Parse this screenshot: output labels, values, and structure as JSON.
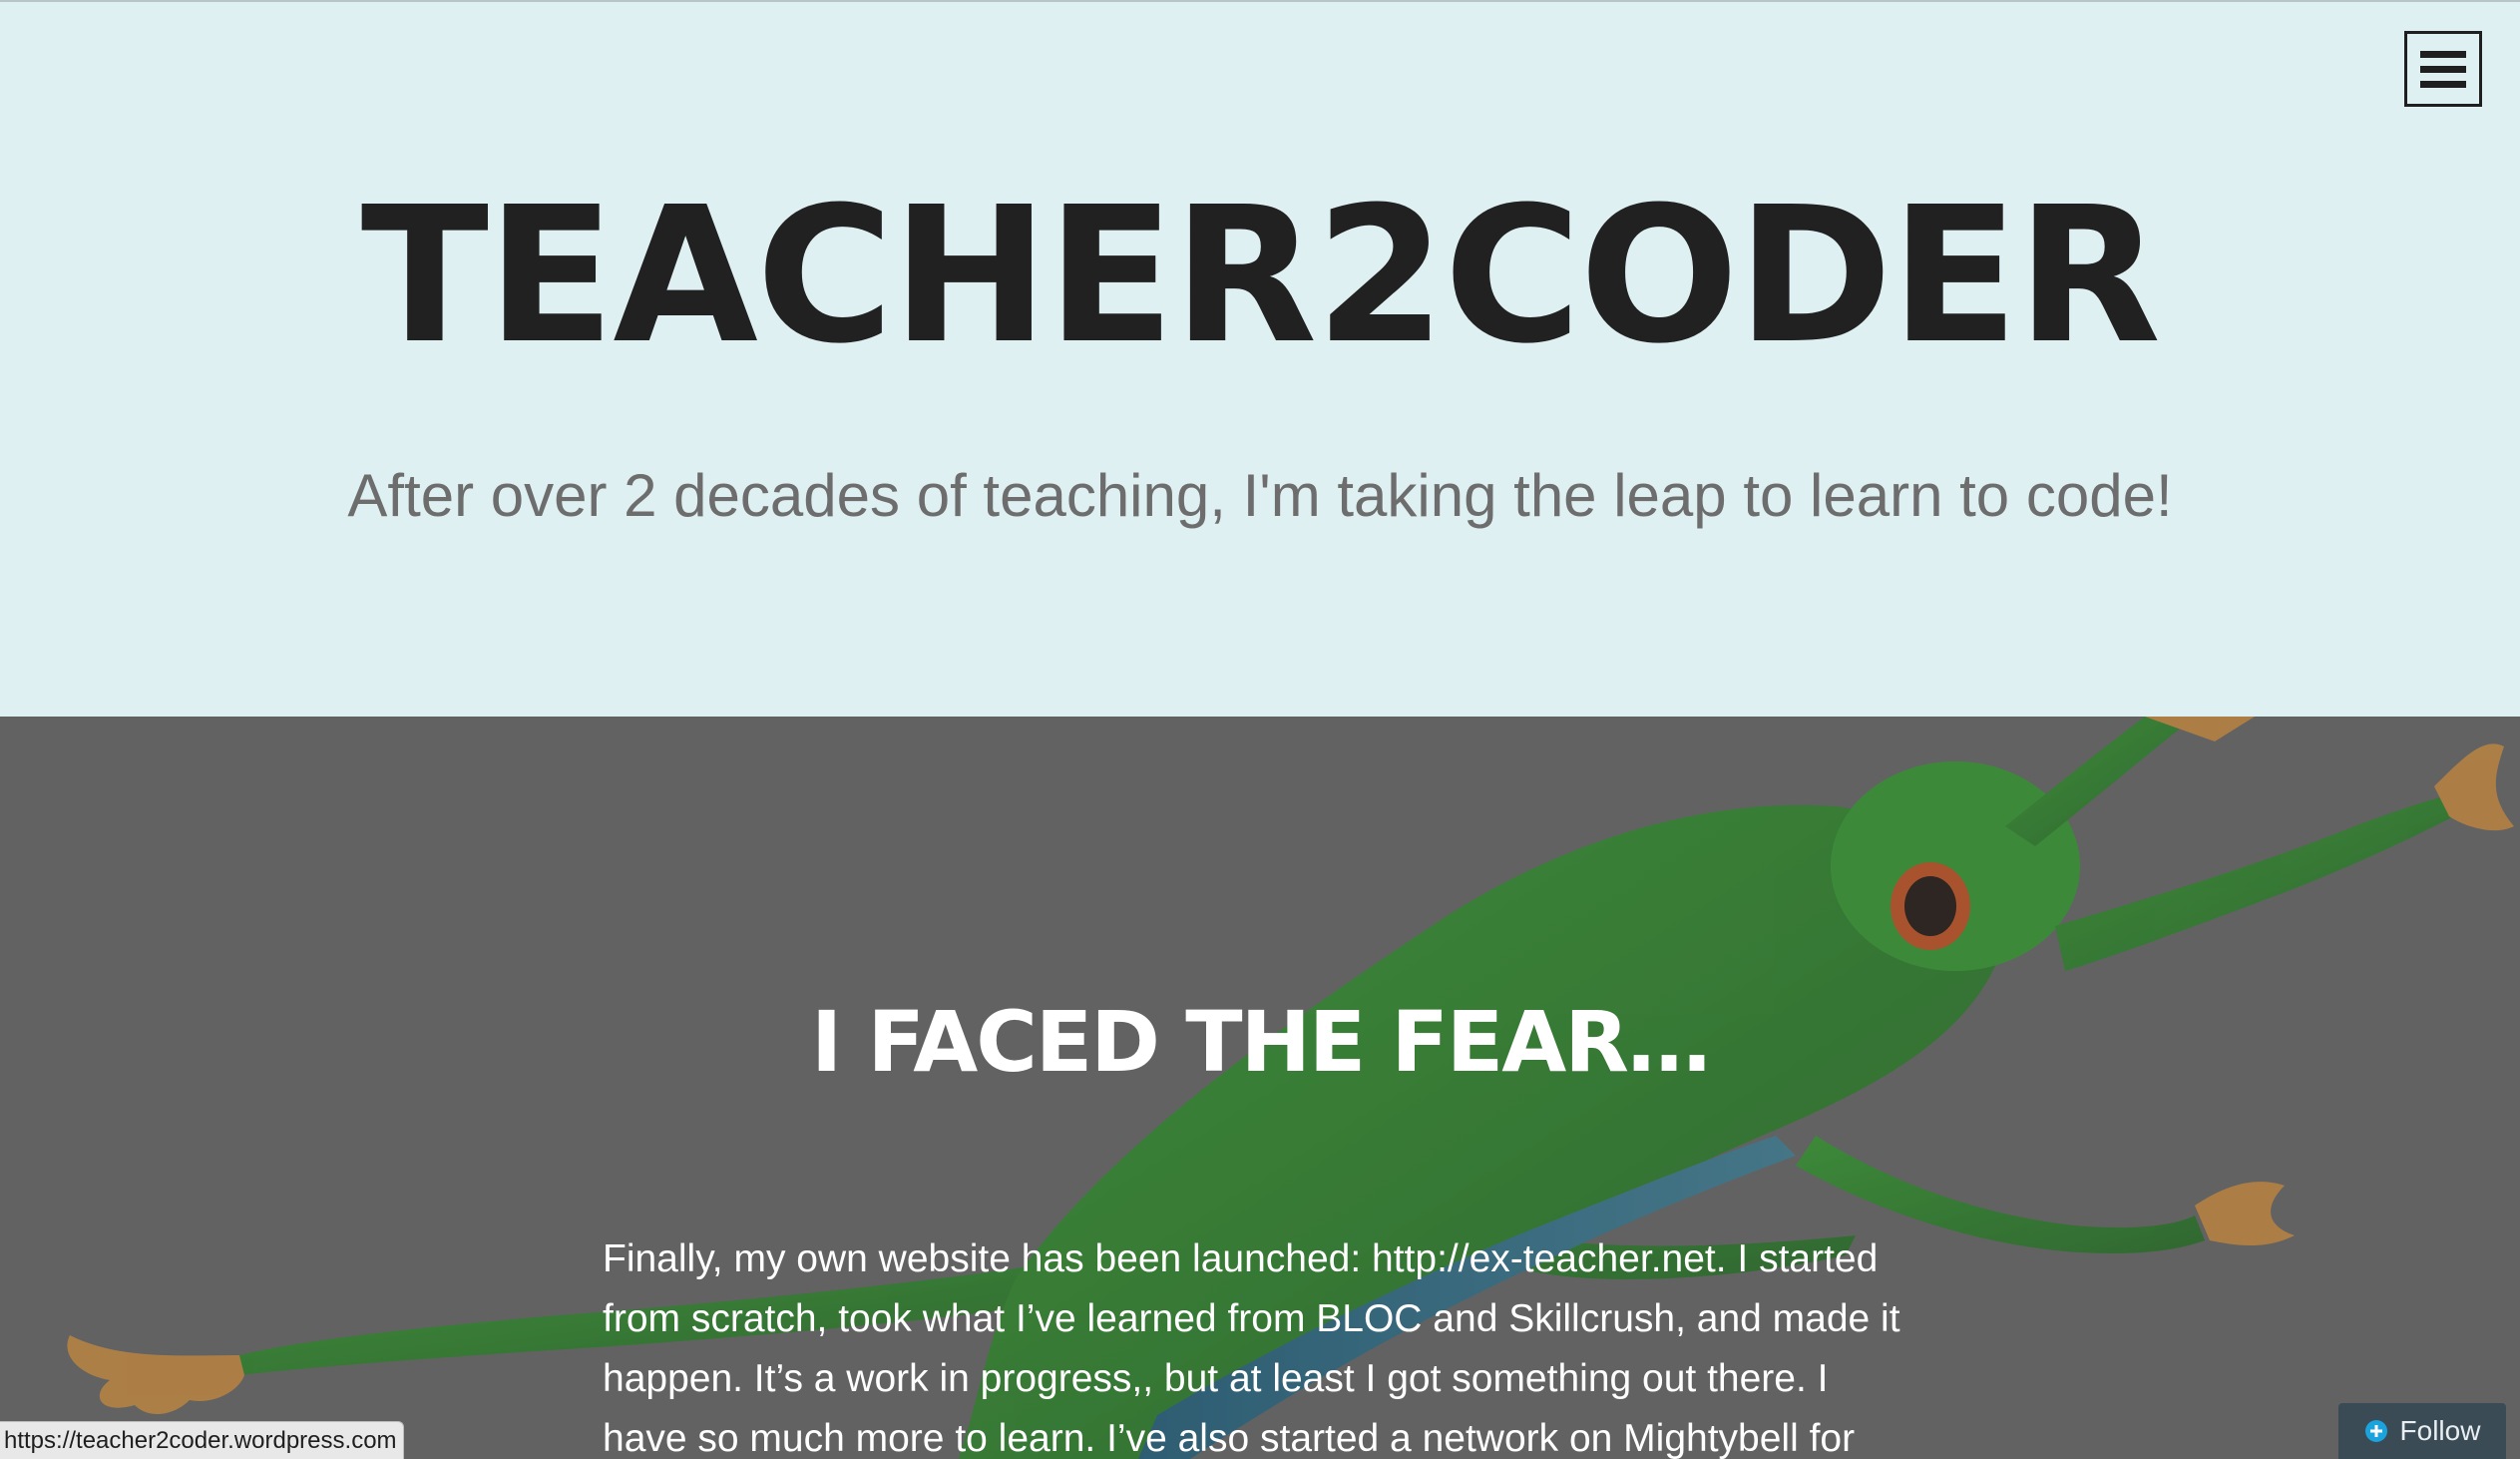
{
  "header": {
    "site_title": "TEACHER2CODER",
    "tagline": "After over 2 decades of teaching, I'm taking the leap to learn to code!",
    "menu_icon": "hamburger-menu-icon",
    "background": "#dff0f3"
  },
  "post": {
    "title": "I FACED THE FEAR…",
    "body": "Finally, my own website has been launched:  http://ex-teacher.net.  I started from scratch, took what I’ve learned from BLOC and Skillcrush, and made it happen.  It’s a work in progress,, but at least I got something out there.   I have so much more to learn.  I’ve also started a network on Mightybell for",
    "featured_image": "leaping-green-tree-frog",
    "overlay_color": "#626262"
  },
  "status_bar": {
    "url": "https://teacher2coder.wordpress.com"
  },
  "follow": {
    "label": "Follow",
    "icon": "plus-circle-icon"
  }
}
